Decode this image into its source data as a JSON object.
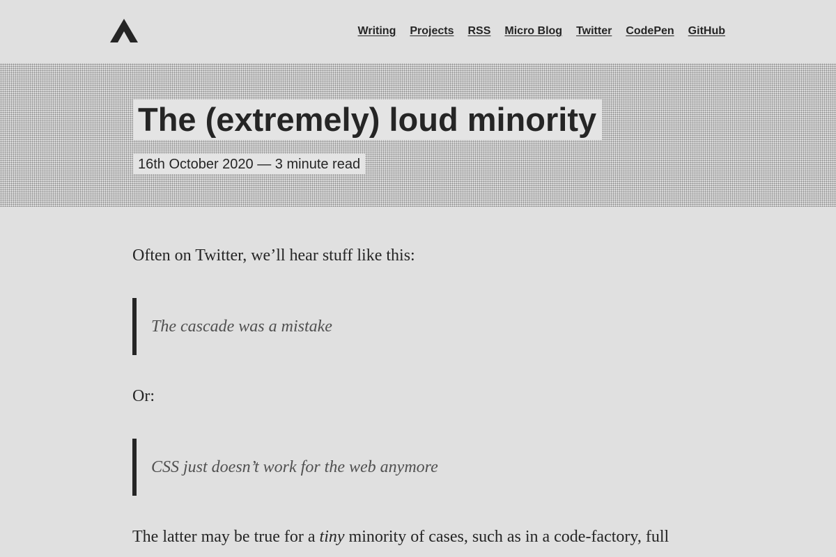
{
  "header": {
    "logo_icon": "triangle-a-logo-icon",
    "nav": {
      "writing": "Writing",
      "projects": "Projects",
      "rss": "RSS",
      "micro_blog": "Micro Blog",
      "twitter": "Twitter",
      "codepen": "CodePen",
      "github": "GitHub"
    }
  },
  "post": {
    "title": "The (extremely) loud minority",
    "meta": "16th October 2020 — 3 minute read"
  },
  "article": {
    "intro": "Often on Twitter, we’ll hear stuff like this:",
    "quote1": "The cascade was a mistake",
    "or": "Or:",
    "quote2": "CSS just doesn’t work for the web anymore",
    "p3_start": "The latter may be true for a ",
    "p3_em": "tiny",
    "p3_end": " minority of cases, such as in a code-factory, full"
  },
  "colors": {
    "background": "#e0e0e0",
    "text": "#252525",
    "quote_text": "#505050"
  }
}
